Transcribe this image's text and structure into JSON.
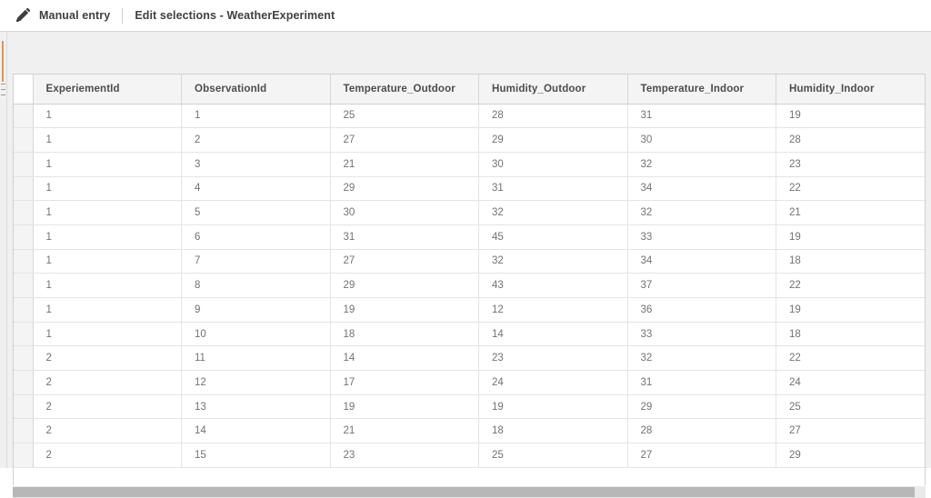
{
  "toolbar": {
    "edit_icon": "pencil-icon",
    "manual_entry_label": "Manual entry",
    "title": "Edit selections - WeatherExperiment"
  },
  "colors": {
    "accent_marker": "#d8956a",
    "header_background": "#f4f4f4",
    "header_text": "#4d4d4d",
    "cell_text": "#737373",
    "canvas_background": "#f0f0f0",
    "scrollbar_thumb": "#b7b7b7"
  },
  "table": {
    "columns": [
      "ExperiementId",
      "ObservationId",
      "Temperature_Outdoor",
      "Humidity_Outdoor",
      "Temperature_Indoor",
      "Humidity_Indoor"
    ],
    "rows": [
      [
        "1",
        "1",
        "25",
        "28",
        "31",
        "19"
      ],
      [
        "1",
        "2",
        "27",
        "29",
        "30",
        "28"
      ],
      [
        "1",
        "3",
        "21",
        "30",
        "32",
        "23"
      ],
      [
        "1",
        "4",
        "29",
        "31",
        "34",
        "22"
      ],
      [
        "1",
        "5",
        "30",
        "32",
        "32",
        "21"
      ],
      [
        "1",
        "6",
        "31",
        "45",
        "33",
        "19"
      ],
      [
        "1",
        "7",
        "27",
        "32",
        "34",
        "18"
      ],
      [
        "1",
        "8",
        "29",
        "43",
        "37",
        "22"
      ],
      [
        "1",
        "9",
        "19",
        "12",
        "36",
        "19"
      ],
      [
        "1",
        "10",
        "18",
        "14",
        "33",
        "18"
      ],
      [
        "2",
        "11",
        "14",
        "23",
        "32",
        "22"
      ],
      [
        "2",
        "12",
        "17",
        "24",
        "31",
        "24"
      ],
      [
        "2",
        "13",
        "19",
        "19",
        "29",
        "25"
      ],
      [
        "2",
        "14",
        "21",
        "18",
        "28",
        "27"
      ],
      [
        "2",
        "15",
        "23",
        "25",
        "27",
        "29"
      ]
    ]
  },
  "scrollbar": {
    "orientation": "horizontal"
  }
}
